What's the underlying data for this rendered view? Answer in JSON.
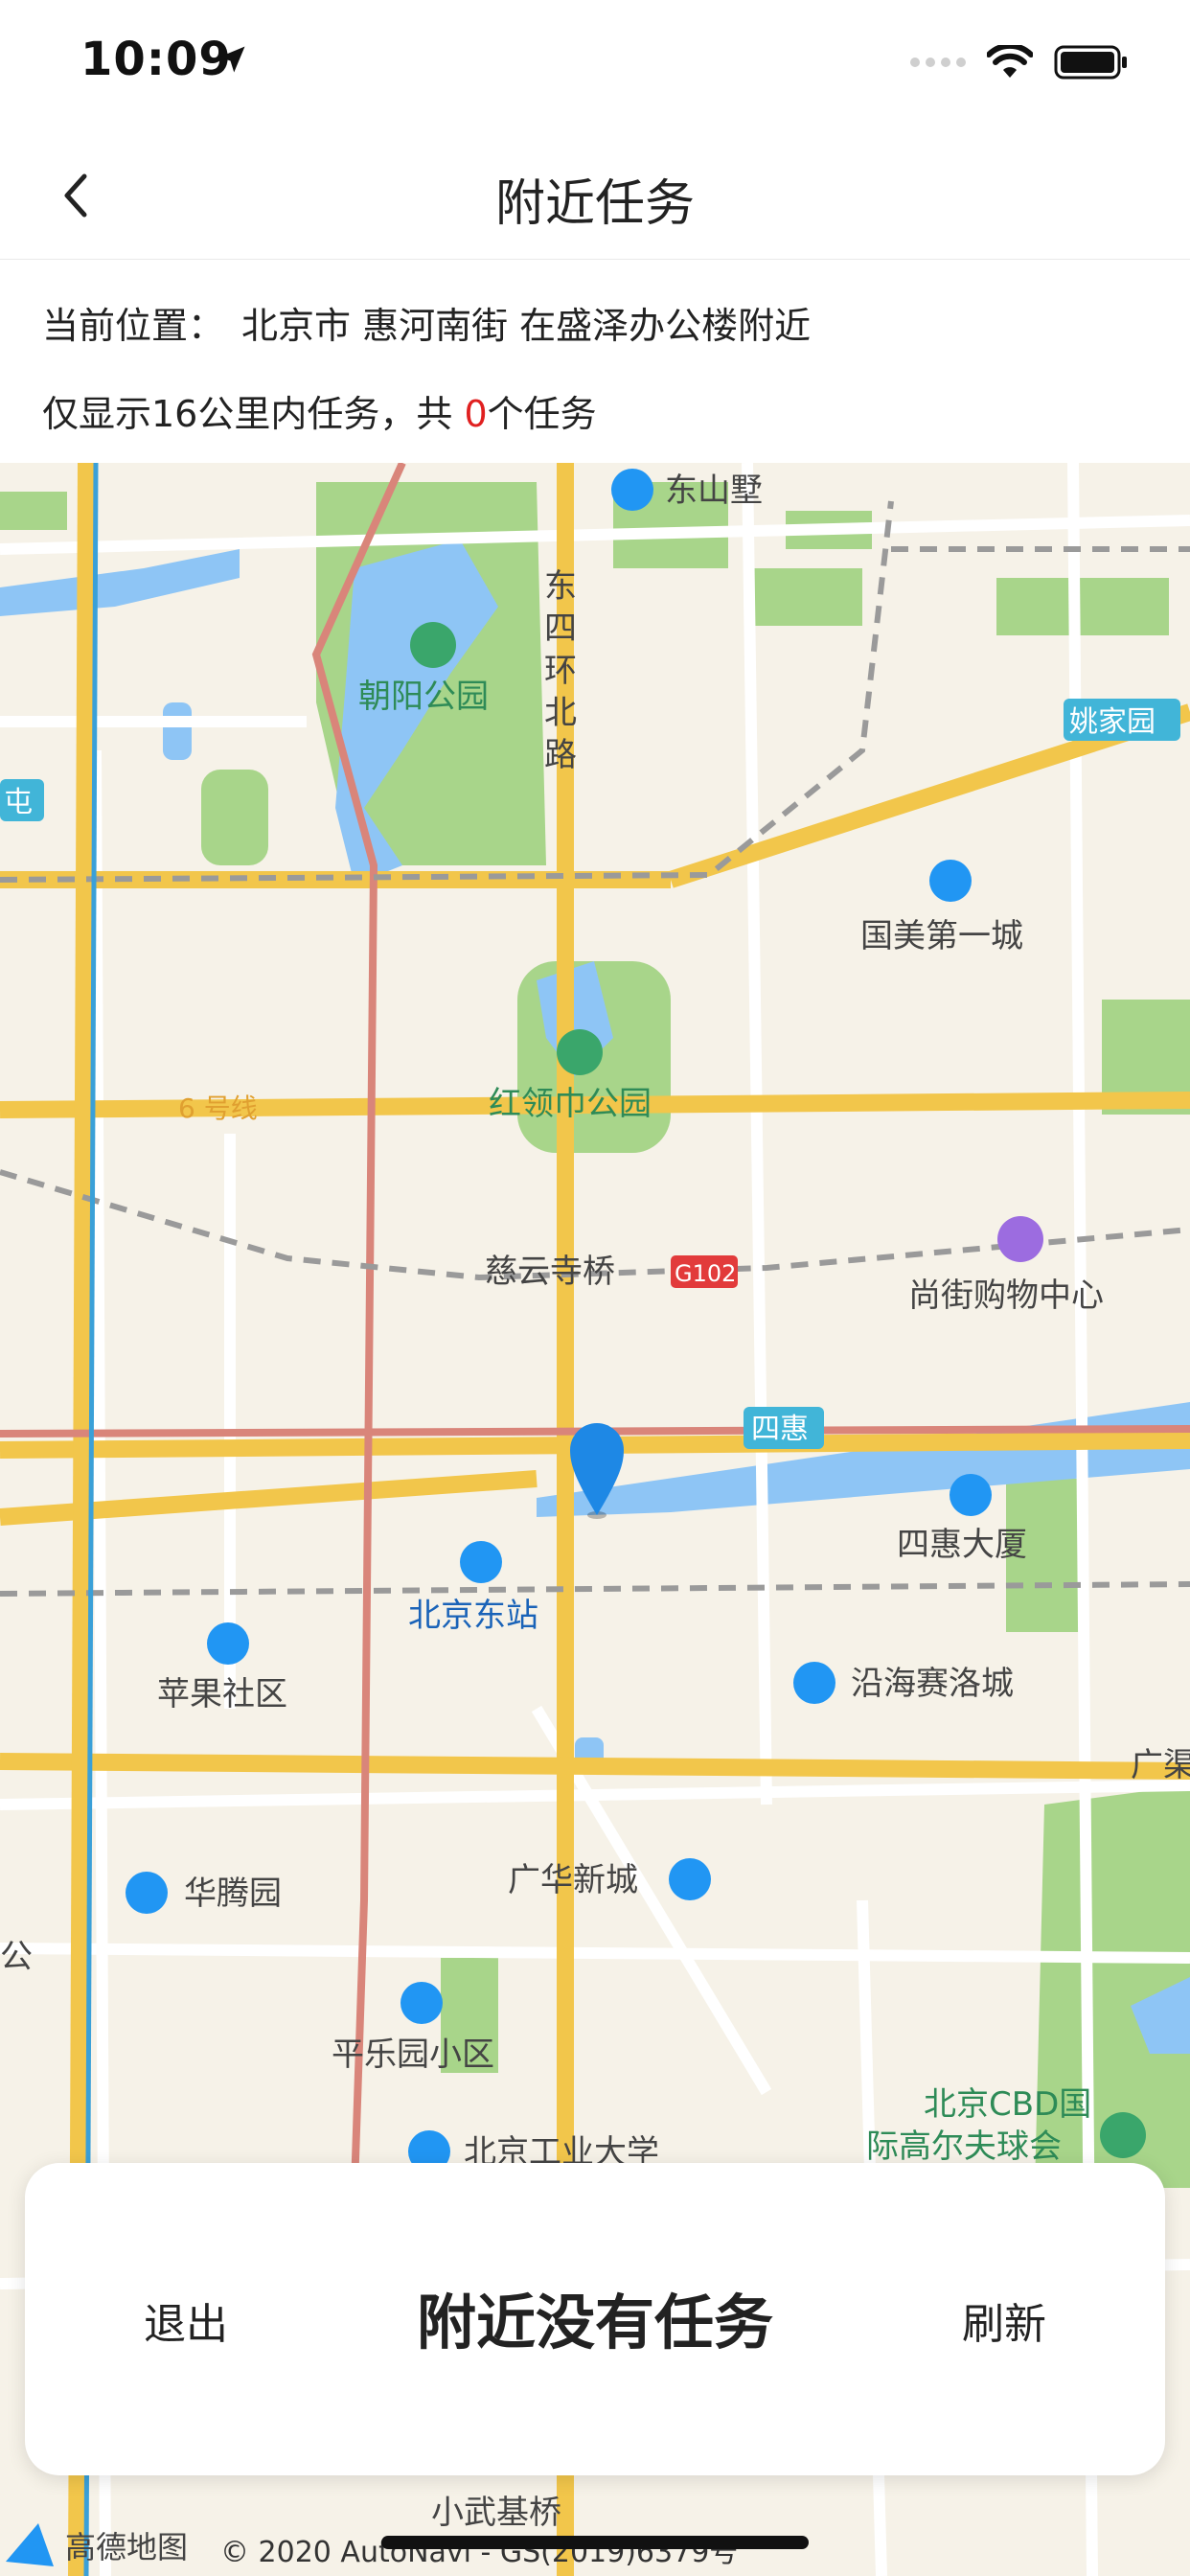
{
  "status_bar": {
    "time": "10:09"
  },
  "nav": {
    "title": "附近任务"
  },
  "info": {
    "location_label": "当前位置：",
    "location_value": "北京市 惠河南街 在盛泽办公楼附近",
    "range_prefix": "仅显示16公里内任务，共 ",
    "task_count": "0",
    "range_suffix": "个任务"
  },
  "map": {
    "labels": {
      "dongshanshu": "东山墅",
      "ring_road_1": "东",
      "ring_road_2": "四",
      "ring_road_3": "环",
      "ring_road_4": "北",
      "ring_road_5": "路",
      "chaoyang_park": "朝阳公园",
      "yaojiayuan": "姚家园",
      "tun": "屯",
      "guomei": "国美第一城",
      "line6": "6 号线",
      "hongling": "红领巾公园",
      "ciyun": "慈云寺桥",
      "g102": "G102",
      "shangjie": "尚街购物中心",
      "sihui_badge": "四惠",
      "sihui_tower": "四惠大厦",
      "beijing_east": "北京东站",
      "pingguo": "苹果社区",
      "yanhai": "沿海赛洛城",
      "guang": "广渠",
      "huateng": "华腾园",
      "guanghua": "广华新城",
      "gong": "公",
      "pingleyuan": "平乐园小区",
      "bjut": "北京工业大学",
      "cbd_1": "北京CBD国",
      "cbd_2": "际高尔夫球会",
      "xiaowuji": "小武基桥",
      "gaode": "高德地图",
      "copyright": "© 2020 AutoNavi - GS(2019)6379号"
    },
    "colors": {
      "background": "#f6f2e8",
      "road_yellow": "#f2c64b",
      "green": "#a8d58a",
      "water": "#8ec5f5",
      "pin": "#1e88e5"
    }
  },
  "card": {
    "exit_label": "退出",
    "title": "附近没有任务",
    "refresh_label": "刷新"
  }
}
